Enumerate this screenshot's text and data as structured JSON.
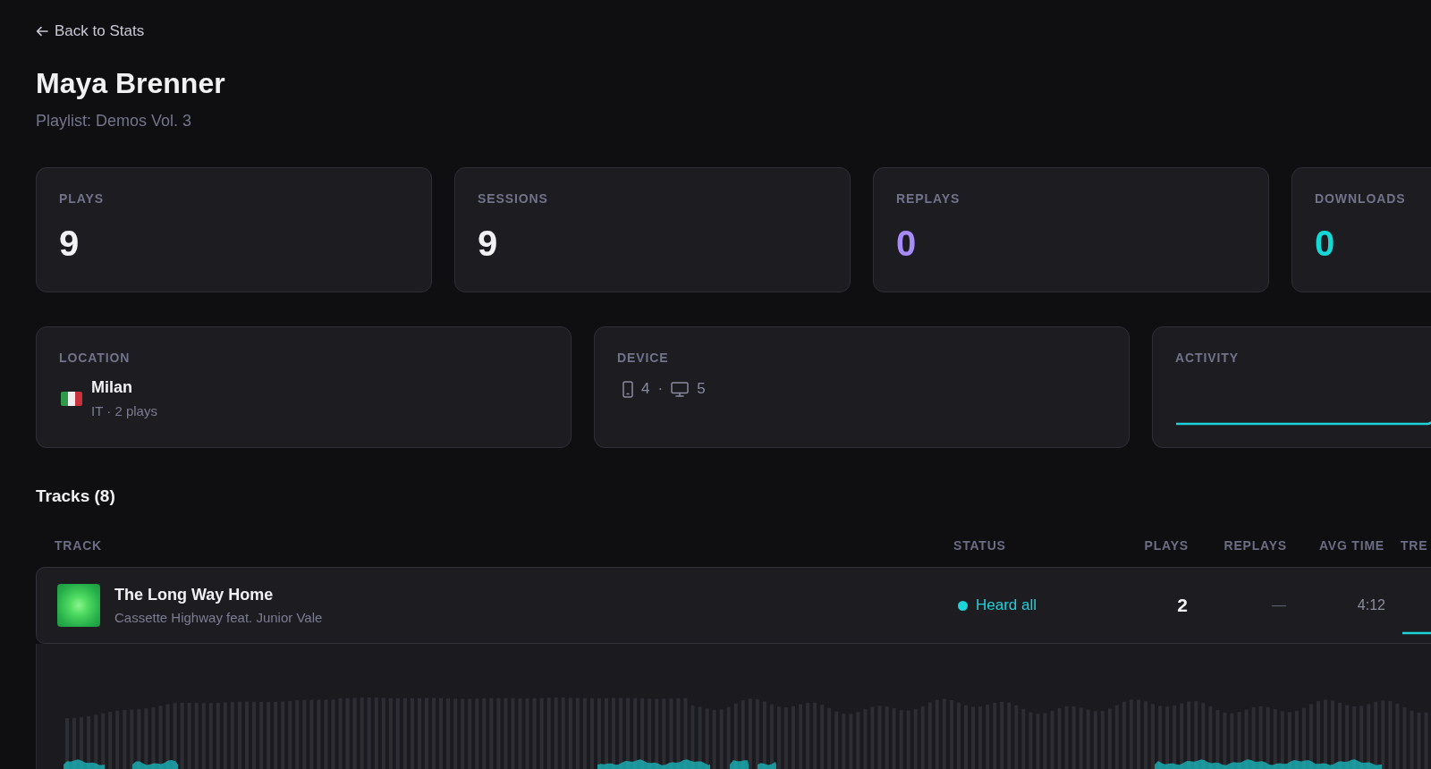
{
  "back_link": {
    "label": "Back to Stats"
  },
  "header": {
    "title": "Maya Brenner",
    "subtitle": "Playlist: Demos Vol. 3"
  },
  "stats": [
    {
      "label": "PLAYS",
      "value": "9",
      "color": "#f2f2f5"
    },
    {
      "label": "SESSIONS",
      "value": "9",
      "color": "#f2f2f5"
    },
    {
      "label": "REPLAYS",
      "value": "0",
      "color": "#a78bfa"
    },
    {
      "label": "DOWNLOADS",
      "value": "0",
      "color": "#14d8d8"
    }
  ],
  "location": {
    "label": "LOCATION",
    "city": "Milan",
    "detail": "IT · 2 plays"
  },
  "device": {
    "label": "DEVICE",
    "items": [
      {
        "kind": "phone",
        "count": "4"
      },
      {
        "kind": "desktop",
        "count": "5"
      }
    ],
    "separator": "·"
  },
  "activity": {
    "label": "ACTIVITY"
  },
  "tracks": {
    "title": "Tracks (8)",
    "columns": [
      "TRACK",
      "STATUS",
      "PLAYS",
      "REPLAYS",
      "AVG TIME",
      "TRE"
    ],
    "rows": [
      {
        "title": "The Long Way Home",
        "artist": "Cassette Highway feat. Junior Vale",
        "status": {
          "label": "Heard all",
          "color": "#1cd3da"
        },
        "plays": "2",
        "replays": "—",
        "avg_time": "4:12",
        "expanded": true
      }
    ]
  }
}
